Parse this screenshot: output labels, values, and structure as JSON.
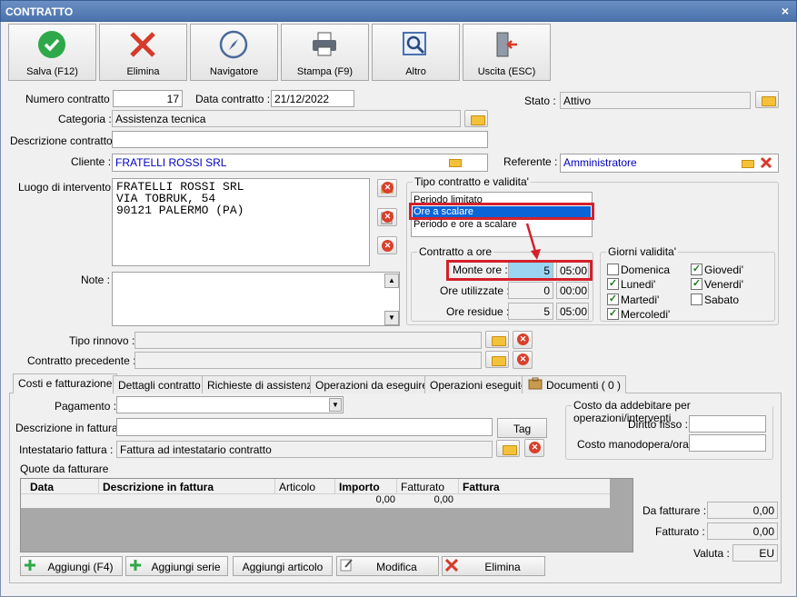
{
  "window": {
    "title": "CONTRATTO",
    "close": "×"
  },
  "toolbar": [
    {
      "label": "Salva (F12)",
      "icon": "check-icon"
    },
    {
      "label": "Elimina",
      "icon": "delete-x-icon"
    },
    {
      "label": "Navigatore",
      "icon": "compass-icon"
    },
    {
      "label": "Stampa (F9)",
      "icon": "printer-icon"
    },
    {
      "label": "Altro",
      "icon": "magnifier-icon"
    },
    {
      "label": "Uscita (ESC)",
      "icon": "exit-door-icon"
    }
  ],
  "form": {
    "numero_label": "Numero contratto :",
    "numero": "17",
    "data_label": "Data contratto :",
    "data": "21/12/2022",
    "stato_label": "Stato :",
    "stato": "Attivo",
    "categoria_label": "Categoria :",
    "categoria": "Assistenza tecnica",
    "descrizione_label": "Descrizione contratto :",
    "descrizione": "",
    "cliente_label": "Cliente :",
    "cliente": "FRATELLI ROSSI SRL",
    "referente_label": "Referente :",
    "referente": "Amministratore",
    "luogo_label": "Luogo di intervento :",
    "luogo_l1": "FRATELLI ROSSI SRL",
    "luogo_l2": "VIA TOBRUK, 54",
    "luogo_l3": "90121 PALERMO (PA)",
    "note_label": "Note :",
    "rinnovo_label": "Tipo rinnovo :",
    "precedente_label": "Contratto precedente :"
  },
  "tipo": {
    "title": "Tipo contratto e validita'",
    "options": [
      "Periodo limitato",
      "Ore a scalare",
      "Periodo e ore a scalare"
    ],
    "selected": "Ore a scalare"
  },
  "ore": {
    "title": "Contratto a ore",
    "monte_label": "Monte ore :",
    "monte": "5",
    "monte_t": "05:00",
    "utilizzate_label": "Ore utilizzate :",
    "utilizzate": "0",
    "utilizzate_t": "00:00",
    "residue_label": "Ore residue :",
    "residue": "5",
    "residue_t": "05:00"
  },
  "giorni": {
    "title": "Giorni validita'",
    "domenica": "Domenica",
    "lunedi": "Lunedi'",
    "martedi": "Martedi'",
    "mercoledi": "Mercoledi'",
    "giovedi": "Giovedi'",
    "venerdi": "Venerdi'",
    "sabato": "Sabato",
    "check": "✓"
  },
  "tabs": [
    "Costi e fatturazione",
    "Dettagli contratto",
    "Richieste di assistenza",
    "Operazioni da eseguire",
    "Operazioni eseguite",
    "Documenti ( 0 )"
  ],
  "costi": {
    "pagamento_label": "Pagamento :",
    "descfatt_label": "Descrizione in fattura",
    "tag": "Tag",
    "intestatario_label": "Intestatario fattura :",
    "intestatario": "Fattura ad intestatario contratto",
    "quote_label": "Quote da fatturare",
    "addebito_title": "Costo da addebitare per operazioni/interventi",
    "diritto_label": "Diritto fisso :",
    "manodopera_label": "Costo manodopera/ora :",
    "table": {
      "headers": [
        "Data",
        "Descrizione in fattura",
        "Articolo",
        "Importo",
        "Fatturato",
        "Fattura"
      ],
      "importo": "0,00",
      "fatturato": "0,00"
    },
    "dafatturare_label": "Da fatturare :",
    "dafatturare": "0,00",
    "fatturato_label": "Fatturato :",
    "fatturato": "0,00",
    "valuta_label": "Valuta :",
    "valuta": "EU"
  },
  "bottom": {
    "aggiungi": "Aggiungi (F4)",
    "serie": "Aggiungi serie",
    "articolo": "Aggiungi articolo",
    "modifica": "Modifica",
    "elimina": "Elimina"
  },
  "colors": {
    "highlight": "#d4202a",
    "selection": "#0a64d6",
    "monte_bg": "#9ad4f0"
  }
}
